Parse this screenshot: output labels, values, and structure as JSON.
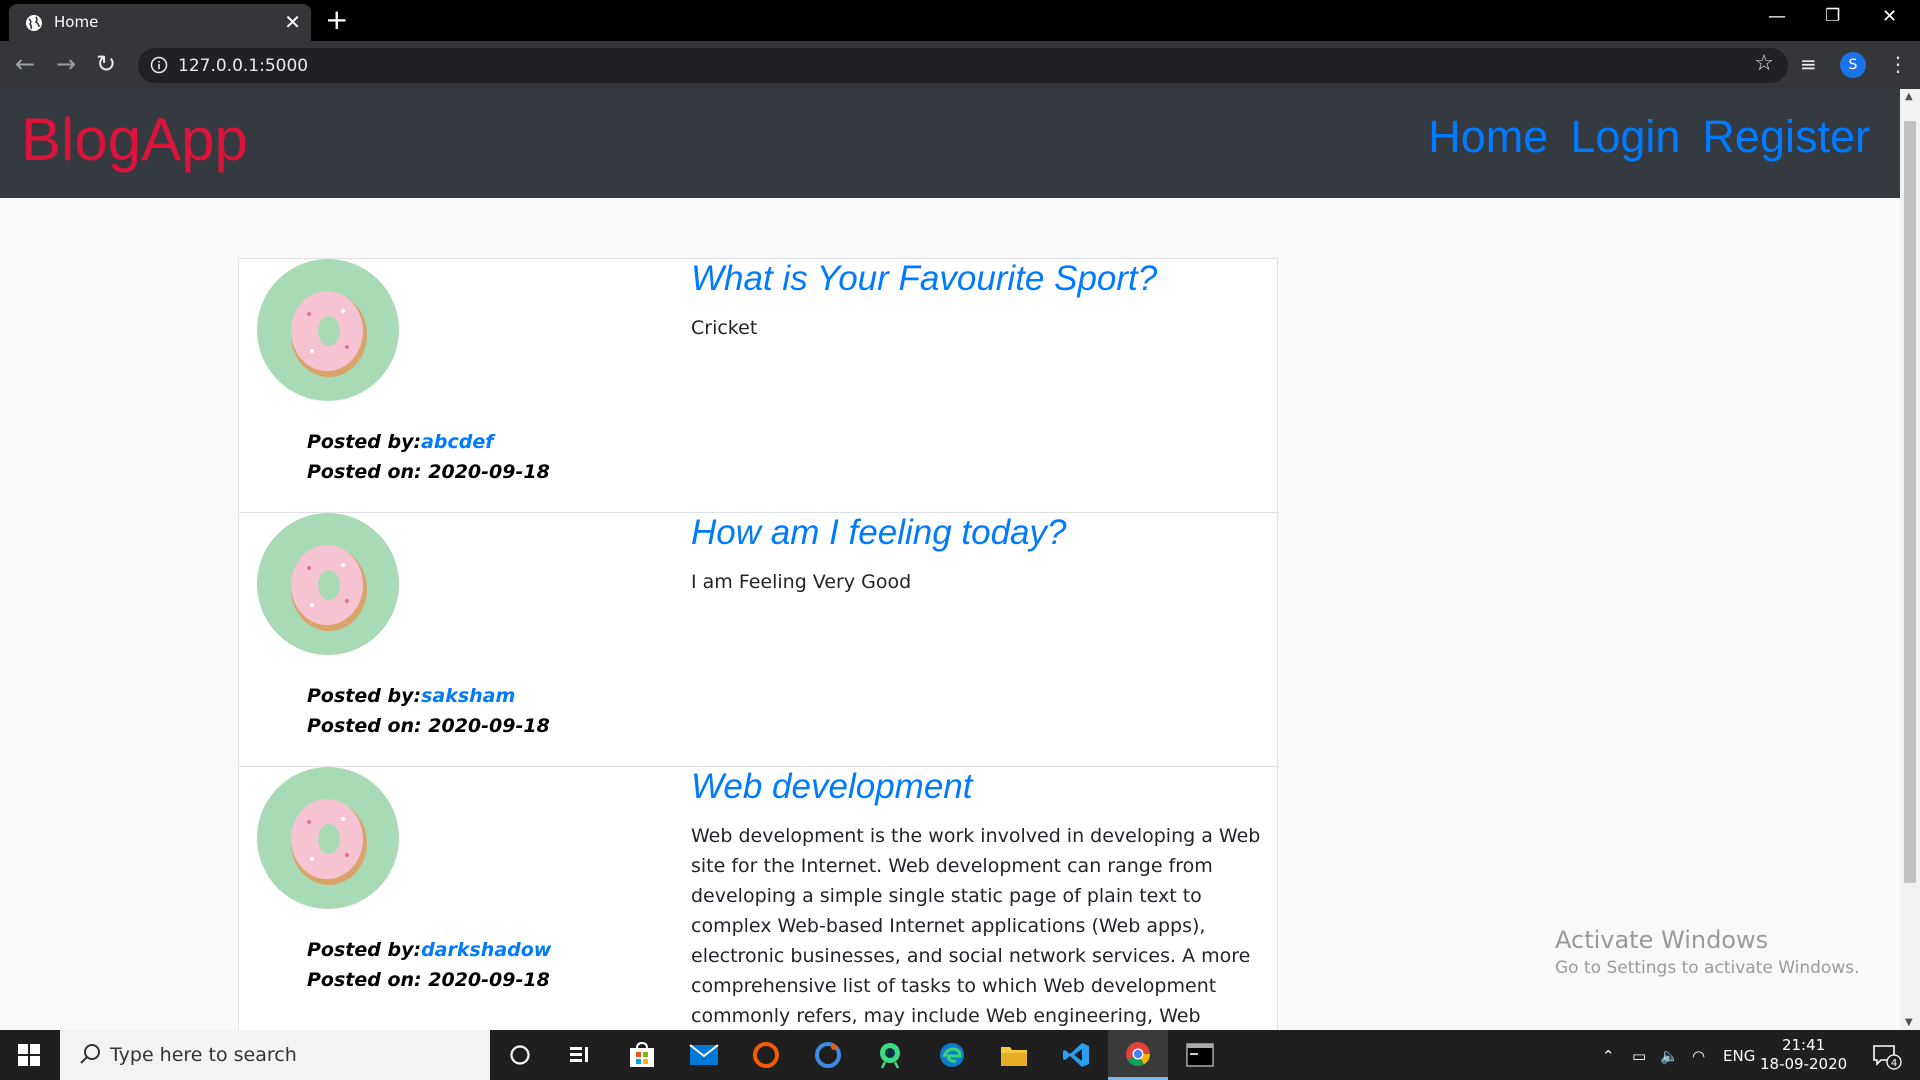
{
  "browser": {
    "tab_title": "Home",
    "url": "127.0.0.1:5000",
    "profile_initial": "S"
  },
  "site": {
    "brand": "BlogApp",
    "nav": [
      {
        "label": "Home"
      },
      {
        "label": "Login"
      },
      {
        "label": "Register"
      }
    ]
  },
  "posts": [
    {
      "title": "What is Your Favourite Sport?",
      "body": "Cricket",
      "posted_by_label": "Posted by:",
      "author": "abcdef",
      "posted_on_label": "Posted on: ",
      "date": "2020-09-18"
    },
    {
      "title": "How am I feeling today?",
      "body": "I am Feeling Very Good",
      "posted_by_label": "Posted by:",
      "author": "saksham",
      "posted_on_label": "Posted on: ",
      "date": "2020-09-18"
    },
    {
      "title": "Web development",
      "body": "Web development is the work involved in developing a Web site for the Internet. Web development can range from developing a simple single static page of plain text to complex Web-based Internet applications (Web apps), electronic businesses, and social network services. A more comprehensive list of tasks to which Web development commonly refers, may include Web engineering, Web design, Web content development, client",
      "posted_by_label": "Posted by:",
      "author": "darkshadow",
      "posted_on_label": "Posted on: ",
      "date": "2020-09-18"
    }
  ],
  "watermark": {
    "line1": "Activate Windows",
    "line2": "Go to Settings to activate Windows."
  },
  "taskbar": {
    "search_placeholder": "Type here to search",
    "language": "ENG",
    "time": "21:41",
    "date": "18-09-2020",
    "notification_count": "4"
  },
  "colors": {
    "brand": "#dc143c",
    "link": "#007bff",
    "navbar": "#343a40"
  }
}
